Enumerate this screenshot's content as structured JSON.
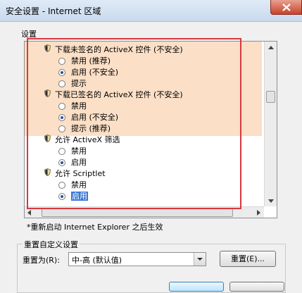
{
  "window": {
    "title": "安全设置 - Internet 区域"
  },
  "settings": {
    "group_label": "设置",
    "items": [
      {
        "type": "header",
        "label": "下载未签名的 ActiveX 控件 (不安全)"
      },
      {
        "type": "radio",
        "label": "禁用 (推荐)",
        "checked": false
      },
      {
        "type": "radio",
        "label": "启用 (不安全)",
        "checked": true
      },
      {
        "type": "radio",
        "label": "提示",
        "checked": false
      },
      {
        "type": "header",
        "label": "下载已签名的 ActiveX 控件 (不安全)"
      },
      {
        "type": "radio",
        "label": "禁用",
        "checked": false
      },
      {
        "type": "radio",
        "label": "启用 (不安全)",
        "checked": true
      },
      {
        "type": "radio",
        "label": "提示 (推荐)",
        "checked": false
      },
      {
        "type": "header",
        "label": "允许 ActiveX 筛选"
      },
      {
        "type": "radio",
        "label": "禁用",
        "checked": false
      },
      {
        "type": "radio",
        "label": "启用",
        "checked": true
      },
      {
        "type": "header",
        "label": "允许 Scriptlet"
      },
      {
        "type": "radio",
        "label": "禁用",
        "checked": false
      },
      {
        "type": "radio",
        "label": "启用",
        "checked": true,
        "selected": true
      }
    ]
  },
  "note": "*重新启动 Internet Explorer 之后生效",
  "reset": {
    "group_label": "重置自定义设置",
    "label": "重置为(R):",
    "selected": "中-高 (默认值)",
    "button": "重置(E)..."
  },
  "colors": {
    "highlight": "#fbdfc6",
    "annotation_box": "#d53a3f",
    "selection": "#3a77d6"
  }
}
